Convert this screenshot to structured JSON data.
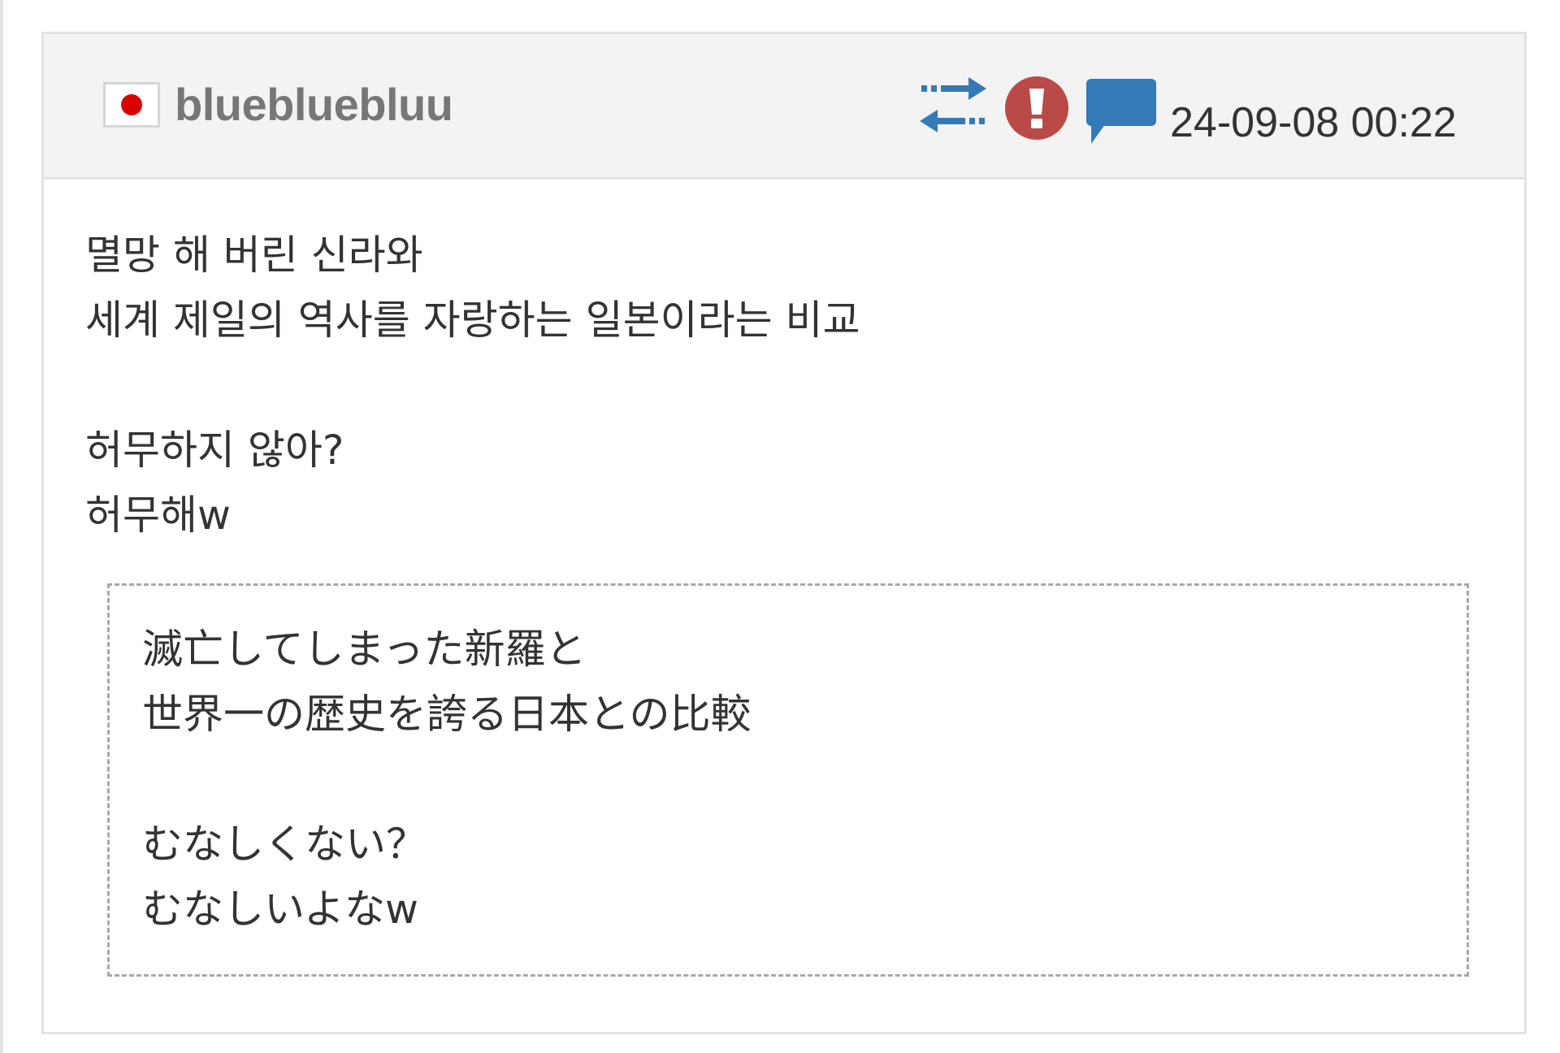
{
  "post": {
    "author": {
      "username": "bluebluebluu",
      "country_flag": "japan-flag-icon"
    },
    "actions": {
      "translate_icon": "swap-arrows-icon",
      "report_icon": "exclamation-icon",
      "reply_icon": "speech-bubble-icon"
    },
    "timestamp": "24-09-08 00:22",
    "body_lines": [
      "멸망 해 버린 신라와",
      "세계 제일의 역사를 자랑하는 일본이라는 비교",
      "",
      "허무하지 않아?",
      "허무해w"
    ],
    "original_lines": [
      "滅亡してしまった新羅と",
      "世界一の歴史を誇る日本との比較",
      "",
      "むなしくない？",
      "むなしいよなw"
    ]
  },
  "colors": {
    "header_bg": "#f3f3f3",
    "border": "#e3e3e3",
    "icon_blue": "#337ab7",
    "report_red": "#b94a48",
    "flag_red": "#d90000",
    "username": "#777777",
    "text": "#333333"
  }
}
